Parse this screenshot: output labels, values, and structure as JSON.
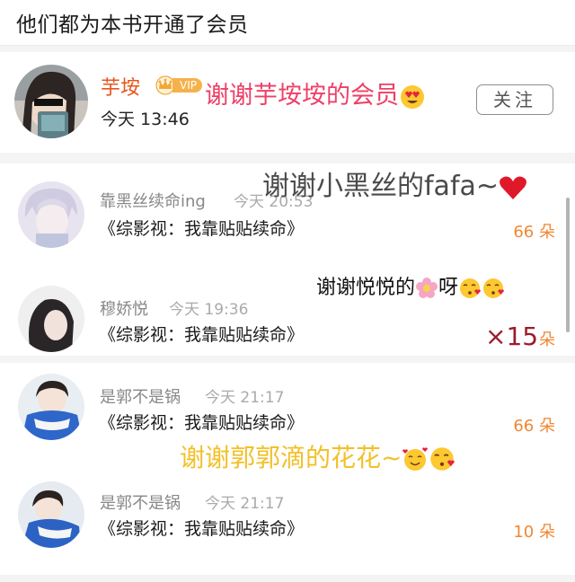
{
  "header": {
    "title": "他们都为本书开通了会员"
  },
  "member": {
    "name": "芋垵",
    "vip_label": "VIP",
    "time": "今天 13:46",
    "follow_label": "关注",
    "thanks_text": "谢谢芋垵垵的会员"
  },
  "overlays": {
    "thanks_row1": "谢谢小黑丝的fafa~",
    "thanks_row2_a": "谢谢悦悦的",
    "thanks_row2_b": "呀",
    "thanks_row3": "谢谢郭郭滴的花花~",
    "multiplier": "×15"
  },
  "gifts": [
    {
      "user": "靠黑丝续命ing",
      "time": "今天 20:53",
      "book": "《综影视：我靠贴贴续命》",
      "count": "66 朵"
    },
    {
      "user": "穆娇悦",
      "time": "今天 19:36",
      "book": "《综影视：我靠贴贴续命》",
      "count": "朵"
    },
    {
      "user": "是郭不是锅",
      "time": "今天 21:17",
      "book": "《综影视：我靠贴贴续命》",
      "count": "66 朵"
    },
    {
      "user": "是郭不是锅",
      "time": "今天 21:17",
      "book": "《综影视：我靠贴贴续命》",
      "count": "10 朵"
    }
  ],
  "colors": {
    "accent": "#f28630",
    "name_orange": "#e8541c",
    "pink_text": "#ee3f66",
    "yellow_text": "#f2c028"
  },
  "icons": [
    "crown-icon",
    "heart-eyes-emoji",
    "red-heart-emoji",
    "flower-emoji",
    "kissing-face-emoji",
    "smiling-face-hearts-emoji"
  ]
}
